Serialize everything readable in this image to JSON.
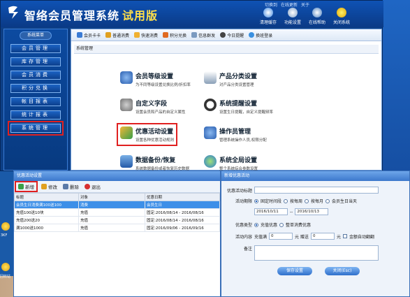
{
  "app": {
    "title": "智络会员管理系统",
    "trial_badge": "试用版",
    "top_links": [
      "切换到",
      "在线更新",
      "关于"
    ],
    "top_buttons": [
      "清理缓存",
      "功能设置",
      "在线帮助",
      "关闭系统"
    ]
  },
  "sidebar": {
    "heading": "系统菜单",
    "items": [
      "会员管理",
      "库存管理",
      "会员消费",
      "积分兑换",
      "帐目报表",
      "统计报表",
      "系统管理"
    ]
  },
  "toolbar": {
    "items": [
      "会员卡卡",
      "普通消费",
      "快速消费",
      "积分兑换",
      "信息群发",
      "今日提醒",
      "换班登录"
    ]
  },
  "content": {
    "section_title": "系统管理",
    "modules": [
      {
        "title": "会员等级设置",
        "desc": "为不同等级设置兑换比例/折扣率"
      },
      {
        "title": "产品分类设置",
        "desc": "对产品分类设置管理"
      },
      {
        "title": "自定义字段",
        "desc": "设置会员和产品的自定义属性"
      },
      {
        "title": "系统提醒设置",
        "desc": "设置生日提醒，自定义提醒频率"
      },
      {
        "title": "优惠活动设置",
        "desc": "设置各种优惠活动规则"
      },
      {
        "title": "操作员管理",
        "desc": "管理系统操作人员,权限分配"
      },
      {
        "title": "数据备份/恢复",
        "desc": "系统数据备份或者恢复历史数据"
      },
      {
        "title": "系统全局设置",
        "desc": "整个系统综合参数设置"
      }
    ]
  },
  "discount_dialog": {
    "title": "优惠活动设置",
    "buttons": [
      "新增",
      "修改",
      "删除",
      "退出"
    ],
    "columns": [
      "标题",
      "对象",
      "优惠日期"
    ],
    "rows": [
      [
        "会员生日消费满100送100",
        "消费",
        "会员生日"
      ],
      [
        "充值100送10块",
        "充值",
        "固定:2016/08/14 - 2016/08/16"
      ],
      [
        "充值200送20",
        "充值",
        "固定:2016/08/14 - 2016/08/16"
      ],
      [
        "满1000送1000",
        "充值",
        "固定:2016/09/06 - 2016/09/16"
      ]
    ]
  },
  "new_dialog": {
    "title": "新增优惠活动",
    "name_label": "优惠活动标题",
    "period_label": "活动期限",
    "period_options": [
      "固定时间段",
      "按每周",
      "按每月",
      "会员生日当天"
    ],
    "date_from": "2016/10/11",
    "date_sep": "--",
    "date_to": "2016/10/13",
    "type_label": "优惠类型",
    "type_options": [
      "充值优惠",
      "整单消费优惠"
    ],
    "content_label": "活动内容",
    "content_pre": "充值满",
    "amount1": "0",
    "unit1": "元 赠送",
    "amount2": "0",
    "unit2": "元",
    "auto_label": "金额自动翻翻",
    "remark_label": "备注",
    "save_button": "保存设置",
    "close_button": "关闭(Esc)"
  },
  "desktop": {
    "icon_label_1": "3KF",
    "icon_label_2": "回收站"
  },
  "colors": {
    "accent": "#1f5fbf",
    "highlight": "#e02020",
    "selected_row": "#3d8fe8"
  }
}
